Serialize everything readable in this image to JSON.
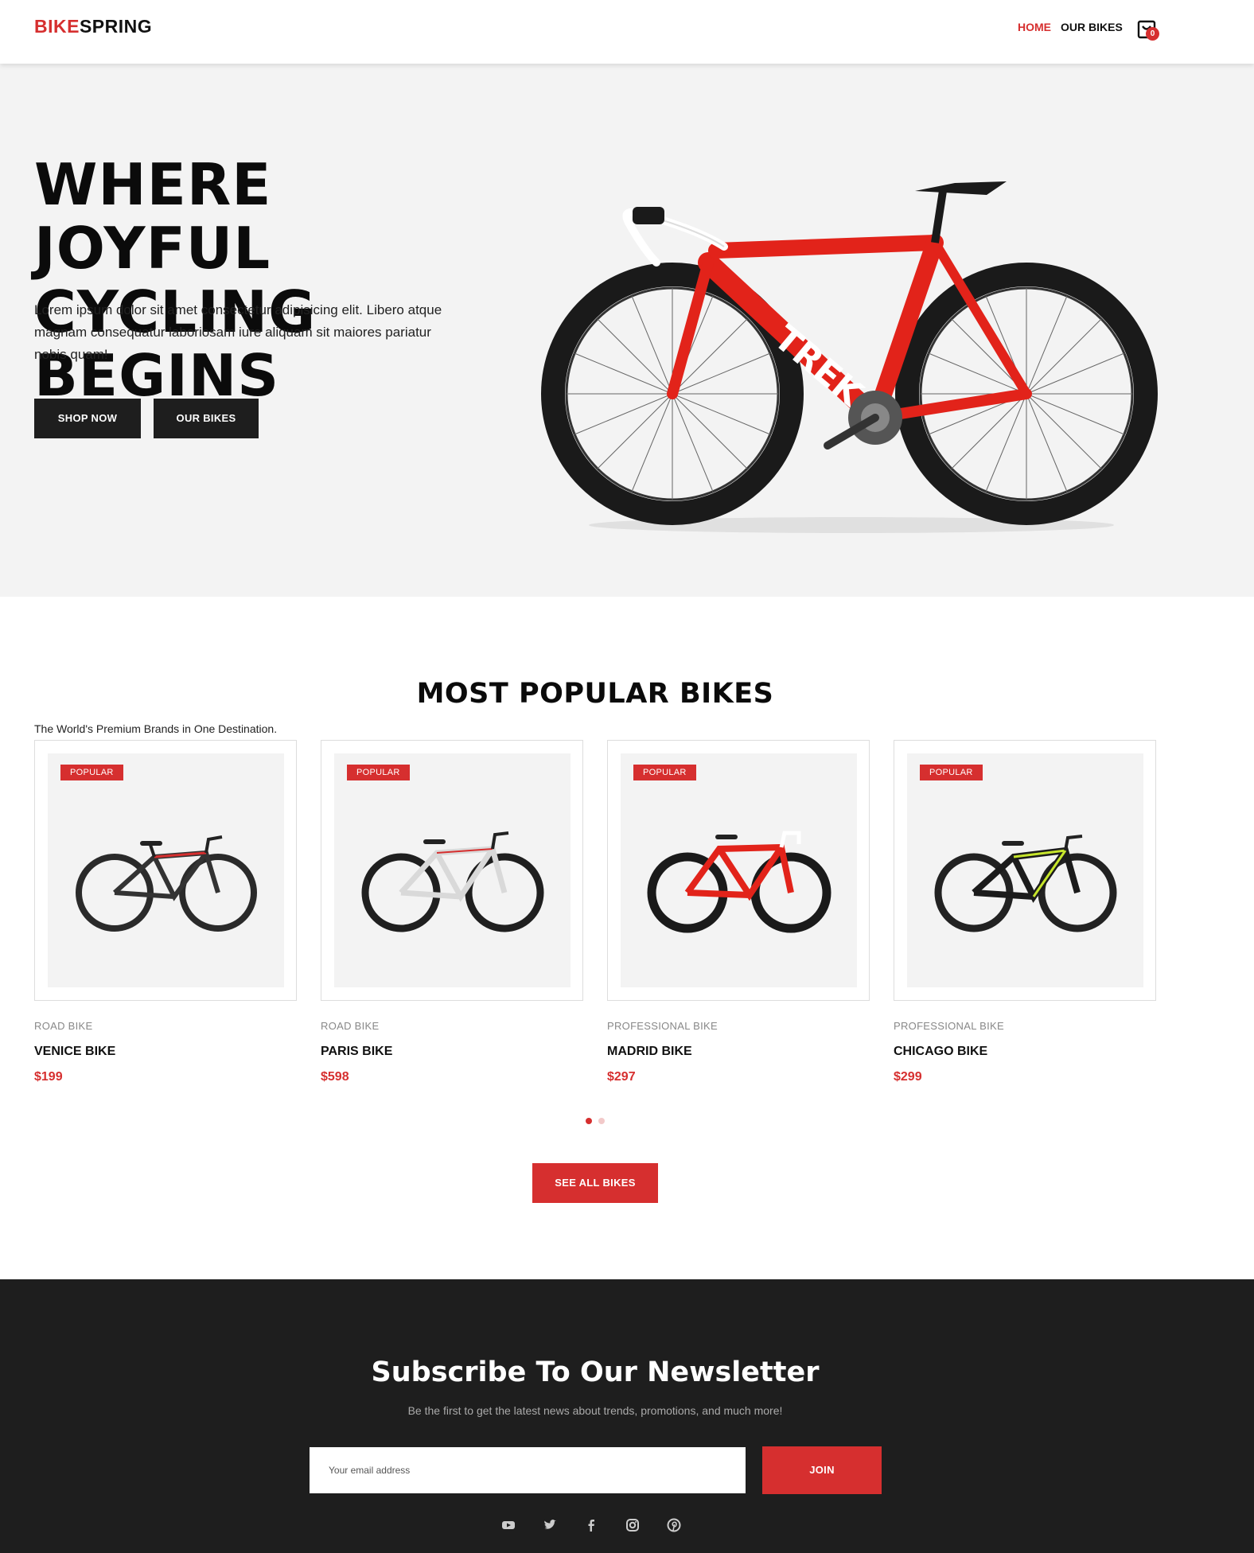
{
  "header": {
    "logo_part1": "BIKE",
    "logo_part2": "SPRING",
    "nav": [
      {
        "label": "HOME"
      },
      {
        "label": "OUR BIKES"
      }
    ],
    "cart_count": "0",
    "accent_color": "#d62f2f"
  },
  "hero": {
    "title_line1": "WHERE JOYFUL",
    "title_line2": "CYCLING BEGINS",
    "text": "Lorem ipsum dolor sit amet consectetur adipisicing elit. Libero atque magnam consequatur laboriosam iure aliquam sit maiores pariatur nobis quam!",
    "shop_now": "SHOP NOW",
    "our_bikes": "OUR BIKES"
  },
  "popular": {
    "title": "MOST POPULAR BIKES",
    "subtitle": "The World's Premium Brands in One Destination.",
    "products": [
      {
        "badge": "POPULAR",
        "category": "ROAD BIKE",
        "name": "VENICE BIKE",
        "price": "$199"
      },
      {
        "badge": "POPULAR",
        "category": "ROAD BIKE",
        "name": "PARIS BIKE",
        "price": "$598"
      },
      {
        "badge": "POPULAR",
        "category": "PROFESSIONAL BIKE",
        "name": "MADRID BIKE",
        "price": "$297"
      },
      {
        "badge": "POPULAR",
        "category": "PROFESSIONAL BIKE",
        "name": "CHICAGO BIKE",
        "price": "$299"
      }
    ],
    "see_all": "SEE ALL BIKES"
  },
  "newsletter": {
    "title": "Subscribe To Our Newsletter",
    "subtitle": "Be the first to get the latest news about trends, promotions, and much more!",
    "placeholder": "Your email address",
    "join": "JOIN",
    "socials": [
      "youtube-icon",
      "twitter-icon",
      "facebook-icon",
      "instagram-icon",
      "pinterest-icon"
    ]
  }
}
